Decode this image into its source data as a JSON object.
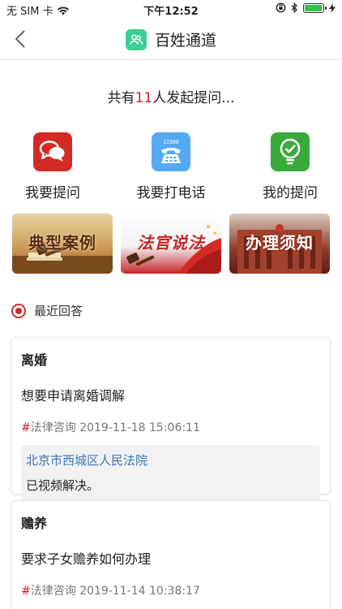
{
  "status_bar": {
    "carrier": "无 SIM 卡",
    "time": "下午12:52",
    "battery_level": 0.95
  },
  "nav": {
    "title": "百姓通道",
    "icon": "people-icon"
  },
  "count_line": {
    "prefix": "共有",
    "count": "11",
    "suffix": "人发起提问..."
  },
  "actions": [
    {
      "label": "我要提问",
      "icon": "chat-bubbles-icon",
      "color": "#d42a25"
    },
    {
      "label": "我要打电话",
      "icon": "phone-12368-icon",
      "color": "#55a8f3",
      "number": "12368"
    },
    {
      "label": "我的提问",
      "icon": "check-badge-icon",
      "color": "#39a93b"
    }
  ],
  "banners": [
    {
      "text": "典型案例",
      "icon": "gavel-books-image"
    },
    {
      "text": "法官说法",
      "icon": "gavel-flag-image"
    },
    {
      "text": "办理须知",
      "icon": "court-building-image"
    }
  ],
  "section": {
    "title": "最近回答",
    "accent": "#cf2b2b"
  },
  "cards": [
    {
      "title": "离婚",
      "question": "想要申请离婚调解",
      "hash": "#",
      "category": "法律咨询",
      "datetime": "2019-11-18 15:06:11",
      "reply_court": "北京市西城区人民法院",
      "reply_text": "已视频解决。"
    },
    {
      "title": "赡养",
      "question": "要求子女赡养如何办理",
      "hash": "#",
      "category": "法律咨询",
      "datetime": "2019-11-14 10:38:17"
    }
  ]
}
